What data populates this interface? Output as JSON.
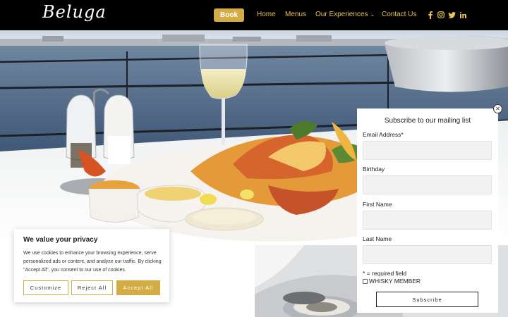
{
  "header": {
    "logo_text": "Beluga",
    "book_label": "Book",
    "nav": {
      "home": "Home",
      "menus": "Menus",
      "experiences": "Our Experiences",
      "contact": "Contact Us"
    },
    "social_icons": [
      "facebook-icon",
      "instagram-icon",
      "twitter-icon",
      "linkedin-icon"
    ]
  },
  "colors": {
    "accent": "#d4ac45",
    "header_bg": "#000000",
    "nav_text": "#e8c25a"
  },
  "cookie": {
    "title": "We value your privacy",
    "text": "We use cookies to enhance your browsing experience, serve personalized ads or content, and analyze our traffic. By clicking \"Accept All\", you consent to our use of cookies.",
    "customize": "Customize",
    "reject": "Reject All",
    "accept": "Accept All"
  },
  "popup": {
    "title": "Subscribe to our mailing list",
    "fields": {
      "email": "Email Address*",
      "birthday": "Birthday",
      "first_name": "First Name",
      "last_name": "Last Name"
    },
    "required_note": "* = required field",
    "checkbox_label": "WHISKY MEMBER",
    "subscribe": "Subscribe",
    "close_glyph": "✕"
  }
}
